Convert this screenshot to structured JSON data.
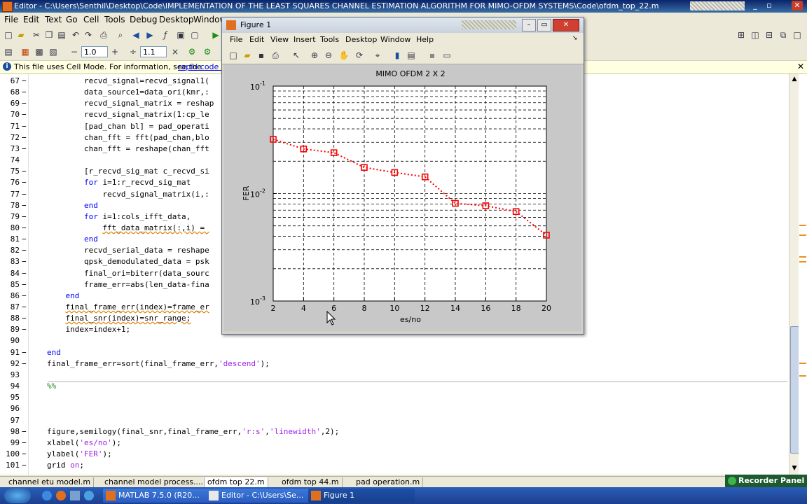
{
  "editor": {
    "title": "Editor - C:\\Users\\Senthil\\Desktop\\Code\\IMPLEMENTATION OF THE LEAST SQUARES CHANNEL ESTIMATION ALGORITHM FOR MIMO-OFDM SYSTEMS\\Code\\ofdm_top_22.m",
    "menu": [
      "File",
      "Edit",
      "Text",
      "Go",
      "Cell",
      "Tools",
      "Debug",
      "Desktop",
      "Window"
    ],
    "cell_toolbar": {
      "minus": "−",
      "value1": "1.0",
      "plus": "+",
      "divide": "÷",
      "value2": "1.1",
      "times": "×"
    },
    "info_text": "This file uses Cell Mode. For information, see the",
    "info_link": "rapid code ite",
    "lines": [
      {
        "n": "67",
        "dash": true,
        "indent": 12,
        "text": "recvd_signal=recvd_signal1("
      },
      {
        "n": "68",
        "dash": true,
        "indent": 12,
        "text": "data_source1=data_ori(kmr,:"
      },
      {
        "n": "69",
        "dash": true,
        "indent": 12,
        "text": "recvd_signal_matrix = reshap"
      },
      {
        "n": "70",
        "dash": true,
        "indent": 12,
        "text": "recvd_signal_matrix(1:cp_le"
      },
      {
        "n": "71",
        "dash": true,
        "indent": 12,
        "text": "[pad_chan bl] = pad_operati"
      },
      {
        "n": "72",
        "dash": true,
        "indent": 12,
        "text": "chan_fft = fft(pad_chan,blo"
      },
      {
        "n": "73",
        "dash": true,
        "indent": 12,
        "text": "chan_fft = reshape(chan_fft"
      },
      {
        "n": "74",
        "dash": false,
        "indent": 0,
        "text": ""
      },
      {
        "n": "75",
        "dash": true,
        "indent": 12,
        "text": "[r_recvd_sig_mat c_recvd_si"
      },
      {
        "n": "76",
        "dash": true,
        "indent": 12,
        "kw": "for",
        "text": " i=1:r_recvd_sig_mat"
      },
      {
        "n": "77",
        "dash": true,
        "indent": 16,
        "text": "recvd_signal_matrix(i,:"
      },
      {
        "n": "78",
        "dash": true,
        "indent": 12,
        "kw": "end",
        "text": ""
      },
      {
        "n": "79",
        "dash": true,
        "indent": 12,
        "kw": "for",
        "text": " i=1:cols_ifft_data,"
      },
      {
        "n": "80",
        "dash": true,
        "indent": 16,
        "text": "fft_data_matrix(:,i) = ",
        "wavy": true
      },
      {
        "n": "81",
        "dash": true,
        "indent": 12,
        "kw": "end",
        "text": ""
      },
      {
        "n": "82",
        "dash": true,
        "indent": 12,
        "text": "recvd_serial_data = reshape"
      },
      {
        "n": "83",
        "dash": true,
        "indent": 12,
        "text": "qpsk_demodulated_data = psk"
      },
      {
        "n": "84",
        "dash": true,
        "indent": 12,
        "text": "final_ori=biterr(data_sourc"
      },
      {
        "n": "85",
        "dash": true,
        "indent": 12,
        "text": "frame_err=abs(len_data-fina"
      },
      {
        "n": "86",
        "dash": true,
        "indent": 8,
        "kw": "end",
        "text": ""
      },
      {
        "n": "87",
        "dash": true,
        "indent": 8,
        "text": "final_frame_err(index)=frame_er",
        "wavy": true
      },
      {
        "n": "88",
        "dash": true,
        "indent": 8,
        "text": "final_snr(index)=snr_range;",
        "wavy": true
      },
      {
        "n": "89",
        "dash": true,
        "indent": 8,
        "text": "index=index+1;"
      },
      {
        "n": "90",
        "dash": false,
        "indent": 0,
        "text": ""
      },
      {
        "n": "91",
        "dash": true,
        "indent": 4,
        "kw": "end",
        "text": ""
      },
      {
        "n": "92",
        "dash": true,
        "indent": 4,
        "text": "final_frame_err=sort(final_frame_err,",
        "str": "'descend'",
        "tail": ");"
      },
      {
        "n": "93",
        "dash": false,
        "indent": 0,
        "text": ""
      },
      {
        "n": "94",
        "dash": false,
        "indent": 4,
        "cm": "%%",
        "text": ""
      },
      {
        "n": "95",
        "dash": false,
        "indent": 0,
        "text": ""
      },
      {
        "n": "96",
        "dash": false,
        "indent": 0,
        "text": ""
      },
      {
        "n": "97",
        "dash": false,
        "indent": 0,
        "text": ""
      },
      {
        "n": "98",
        "dash": true,
        "indent": 4,
        "text": "figure,semilogy(final_snr,final_frame_err,",
        "str": "'r:s'",
        "mid": ",",
        "str2": "'linewidth'",
        "tail": ",2);"
      },
      {
        "n": "99",
        "dash": true,
        "indent": 4,
        "text": "xlabel(",
        "str": "'es/no'",
        "tail": ");"
      },
      {
        "n": "100",
        "dash": true,
        "indent": 4,
        "text": "ylabel(",
        "str": "'FER'",
        "tail": ");"
      },
      {
        "n": "101",
        "dash": true,
        "indent": 4,
        "text": "grid ",
        "str": "on",
        "tail": ";"
      }
    ],
    "tabs": [
      "channel etu model.m",
      "channel model process....",
      "ofdm top 22.m",
      "ofdm top 44.m",
      "pad operation.m"
    ],
    "active_tab": "ofdm top 22.m"
  },
  "figure": {
    "title": "Figure 1",
    "menu": [
      "File",
      "Edit",
      "View",
      "Insert",
      "Tools",
      "Desktop",
      "Window",
      "Help"
    ]
  },
  "chart_data": {
    "type": "line",
    "title": "MIMO OFDM 2 X 2",
    "xlabel": "es/no",
    "ylabel": "FER",
    "yscale": "log",
    "xlim": [
      2,
      20
    ],
    "ylim": [
      0.001,
      0.1
    ],
    "xticks": [
      "2",
      "4",
      "6",
      "8",
      "10",
      "12",
      "14",
      "16",
      "18",
      "20"
    ],
    "yticks": [
      {
        "base": "10",
        "exp": "-1"
      },
      {
        "base": "10",
        "exp": "-2"
      },
      {
        "base": "10",
        "exp": "-3"
      }
    ],
    "grid": true,
    "series": [
      {
        "x": [
          2,
          4,
          6,
          8,
          10,
          12,
          14,
          16,
          18,
          20
        ],
        "y": [
          0.032,
          0.026,
          0.024,
          0.0175,
          0.0157,
          0.0143,
          0.0081,
          0.0077,
          0.0068,
          0.0041
        ],
        "color": "#ff0000",
        "style": "r:s",
        "marker": "square"
      }
    ]
  },
  "taskbar": {
    "start_label": "",
    "tasks": [
      "MATLAB 7.5.0 (R20...",
      "Editor - C:\\Users\\Se...",
      "Figure 1"
    ],
    "recorder": "Recorder Panel"
  }
}
